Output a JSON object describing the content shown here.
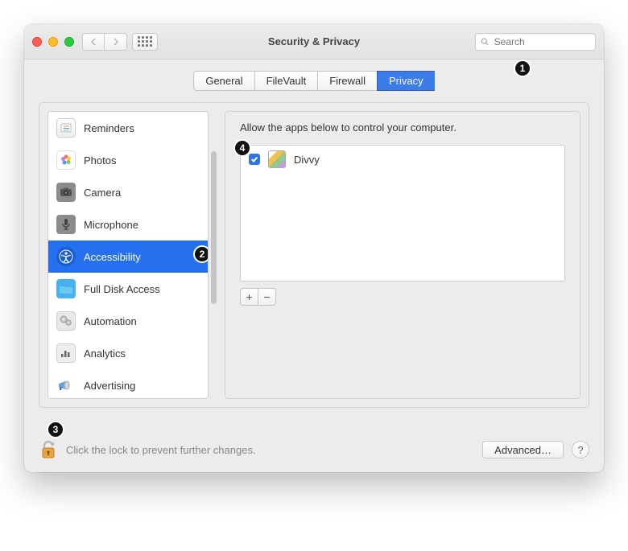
{
  "window_title": "Security & Privacy",
  "search": {
    "placeholder": "Search"
  },
  "tabs": [
    {
      "label": "General",
      "selected": false
    },
    {
      "label": "FileVault",
      "selected": false
    },
    {
      "label": "Firewall",
      "selected": false
    },
    {
      "label": "Privacy",
      "selected": true
    }
  ],
  "sidebar": {
    "items": [
      {
        "label": "Reminders",
        "icon": "reminders-icon",
        "selected": false
      },
      {
        "label": "Photos",
        "icon": "photos-icon",
        "selected": false
      },
      {
        "label": "Camera",
        "icon": "camera-icon",
        "selected": false
      },
      {
        "label": "Microphone",
        "icon": "microphone-icon",
        "selected": false
      },
      {
        "label": "Accessibility",
        "icon": "accessibility-icon",
        "selected": true
      },
      {
        "label": "Full Disk Access",
        "icon": "folder-icon",
        "selected": false
      },
      {
        "label": "Automation",
        "icon": "gear-icon",
        "selected": false
      },
      {
        "label": "Analytics",
        "icon": "chart-icon",
        "selected": false
      },
      {
        "label": "Advertising",
        "icon": "megaphone-icon",
        "selected": false
      }
    ]
  },
  "detail": {
    "header": "Allow the apps below to control your computer.",
    "apps": [
      {
        "name": "Divvy",
        "checked": true
      }
    ],
    "add_label": "+",
    "remove_label": "−"
  },
  "footer": {
    "lock_text": "Click the lock to prevent further changes.",
    "advanced_label": "Advanced…",
    "help_label": "?"
  },
  "annotation_badges": [
    "1",
    "2",
    "3",
    "4"
  ]
}
